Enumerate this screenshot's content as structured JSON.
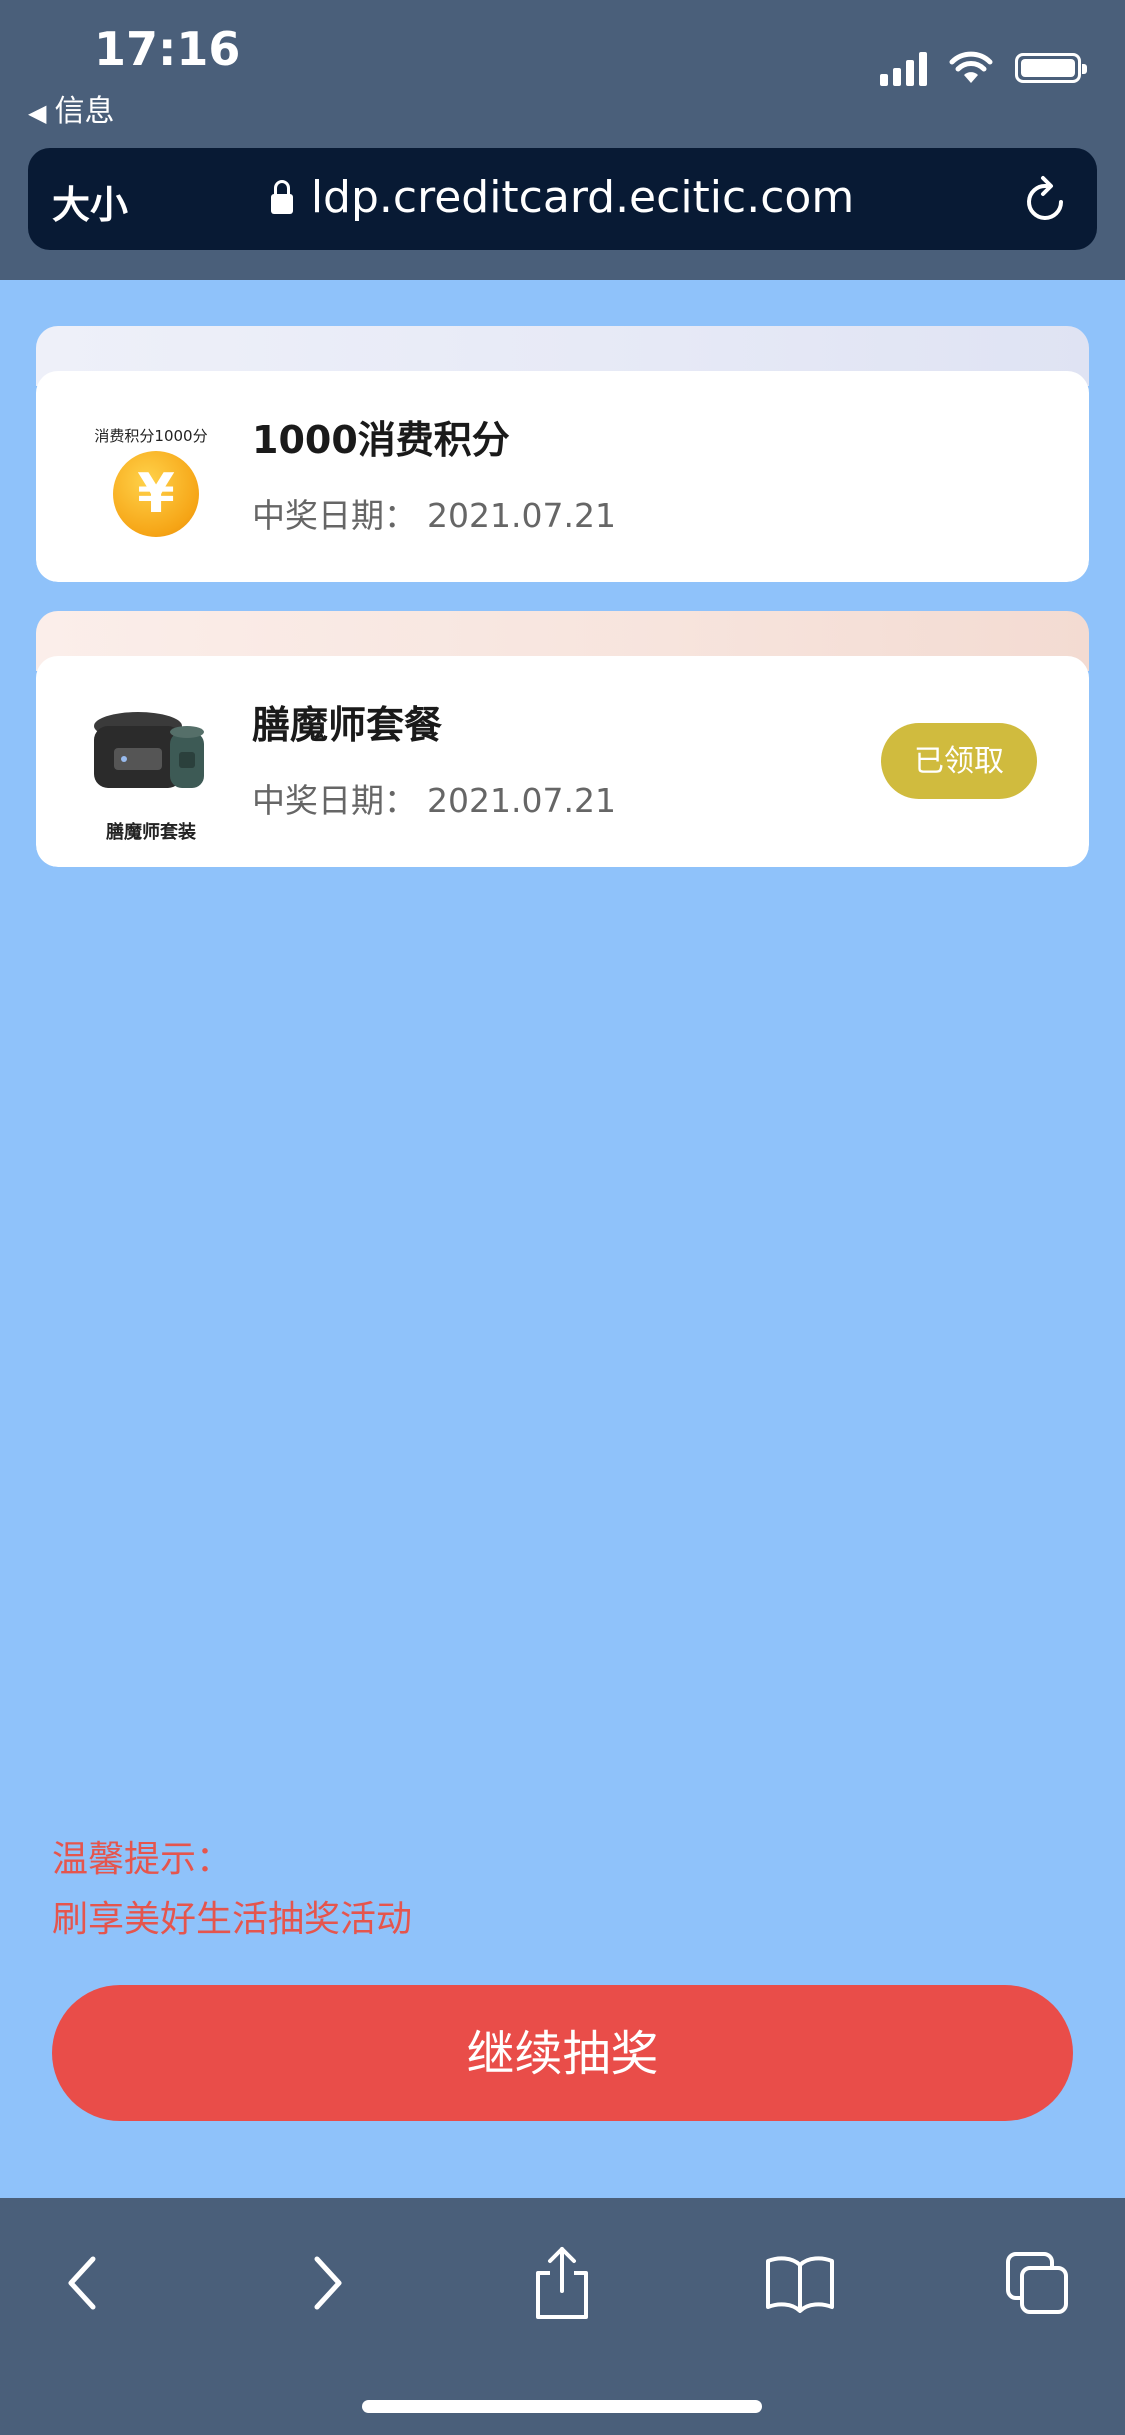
{
  "status_bar": {
    "time": "17:16",
    "back_label": "信息"
  },
  "browser": {
    "text_size_label": "大小",
    "url": "ldp.creditcard.ecitic.com"
  },
  "prizes": [
    {
      "title": "1000消费积分",
      "image_caption": "消费积分1000分",
      "date_label": "中奖日期：",
      "date": "2021.07.21"
    },
    {
      "title": "膳魔师套餐",
      "image_caption": "膳魔师套装",
      "date_label": "中奖日期：",
      "date": "2021.07.21",
      "status_button": "已领取"
    }
  ],
  "tips": {
    "heading": "温馨提示：",
    "text": "刷享美好生活抽奖活动"
  },
  "cta": {
    "label": "继续抽奖"
  },
  "colors": {
    "page_bg": "#8fc2fa",
    "cta_bg": "#e94d49",
    "claimed_bg": "#d0bb3e",
    "tip_text": "#e5554d"
  }
}
